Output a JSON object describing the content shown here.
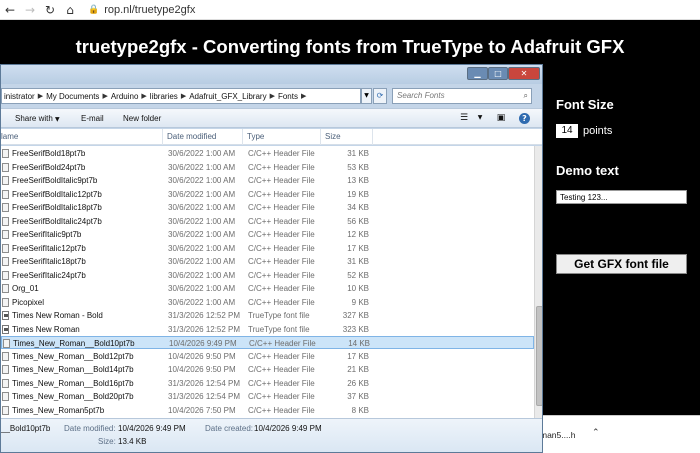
{
  "browser": {
    "url": "rop.nl/truetype2gfx"
  },
  "page": {
    "title": "truetype2gfx - Converting fonts from TrueType to Adafruit GFX",
    "font_size_label": "Font Size",
    "font_size_value": "14",
    "points_label": "points",
    "demo_text_label": "Demo text",
    "demo_text_value": "Testing 123...",
    "get_file_button": "Get GFX font file"
  },
  "download": {
    "filename": "man5....h"
  },
  "explorer": {
    "breadcrumbs": [
      "inistrator",
      "My Documents",
      "Arduino",
      "libraries",
      "Adafruit_GFX_Library",
      "Fonts"
    ],
    "search_placeholder": "Search Fonts",
    "toolbar": {
      "share": "Share with",
      "email": "E-mail",
      "new_folder": "New folder"
    },
    "columns": {
      "name": "lame",
      "date": "Date modified",
      "type": "Type",
      "size": "Size"
    },
    "files": [
      {
        "name": "FreeSerifBold18pt7b",
        "date": "30/6/2022 1:00 AM",
        "type": "C/C++ Header File",
        "size": "31 KB"
      },
      {
        "name": "FreeSerifBold24pt7b",
        "date": "30/6/2022 1:00 AM",
        "type": "C/C++ Header File",
        "size": "53 KB"
      },
      {
        "name": "FreeSerifBoldItalic9pt7b",
        "date": "30/6/2022 1:00 AM",
        "type": "C/C++ Header File",
        "size": "13 KB"
      },
      {
        "name": "FreeSerifBoldItalic12pt7b",
        "date": "30/6/2022 1:00 AM",
        "type": "C/C++ Header File",
        "size": "19 KB"
      },
      {
        "name": "FreeSerifBoldItalic18pt7b",
        "date": "30/6/2022 1:00 AM",
        "type": "C/C++ Header File",
        "size": "34 KB"
      },
      {
        "name": "FreeSerifBoldItalic24pt7b",
        "date": "30/6/2022 1:00 AM",
        "type": "C/C++ Header File",
        "size": "56 KB"
      },
      {
        "name": "FreeSerifItalic9pt7b",
        "date": "30/6/2022 1:00 AM",
        "type": "C/C++ Header File",
        "size": "12 KB"
      },
      {
        "name": "FreeSerifItalic12pt7b",
        "date": "30/6/2022 1:00 AM",
        "type": "C/C++ Header File",
        "size": "17 KB"
      },
      {
        "name": "FreeSerifItalic18pt7b",
        "date": "30/6/2022 1:00 AM",
        "type": "C/C++ Header File",
        "size": "31 KB"
      },
      {
        "name": "FreeSerifItalic24pt7b",
        "date": "30/6/2022 1:00 AM",
        "type": "C/C++ Header File",
        "size": "52 KB"
      },
      {
        "name": "Org_01",
        "date": "30/6/2022 1:00 AM",
        "type": "C/C++ Header File",
        "size": "10 KB"
      },
      {
        "name": "Picopixel",
        "date": "30/6/2022 1:00 AM",
        "type": "C/C++ Header File",
        "size": "9 KB"
      },
      {
        "name": "Times New Roman - Bold",
        "date": "31/3/2026 12:52 PM",
        "type": "TrueType font file",
        "size": "327 KB"
      },
      {
        "name": "Times New Roman",
        "date": "31/3/2026 12:52 PM",
        "type": "TrueType font file",
        "size": "323 KB"
      },
      {
        "name": "Times_New_Roman__Bold10pt7b",
        "date": "10/4/2026 9:49 PM",
        "type": "C/C++ Header File",
        "size": "14 KB"
      },
      {
        "name": "Times_New_Roman__Bold12pt7b",
        "date": "10/4/2026 9:50 PM",
        "type": "C/C++ Header File",
        "size": "17 KB"
      },
      {
        "name": "Times_New_Roman__Bold14pt7b",
        "date": "10/4/2026 9:50 PM",
        "type": "C/C++ Header File",
        "size": "21 KB"
      },
      {
        "name": "Times_New_Roman__Bold16pt7b",
        "date": "31/3/2026 12:54 PM",
        "type": "C/C++ Header File",
        "size": "26 KB"
      },
      {
        "name": "Times_New_Roman__Bold20pt7b",
        "date": "31/3/2026 12:54 PM",
        "type": "C/C++ Header File",
        "size": "37 KB"
      },
      {
        "name": "Times_New_Roman5pt7b",
        "date": "10/4/2026 7:50 PM",
        "type": "C/C++ Header File",
        "size": "8 KB"
      }
    ],
    "selected_index": 14,
    "details": {
      "name": "__Bold10pt7b",
      "date_modified_label": "Date modified:",
      "date_modified": "10/4/2026 9:49 PM",
      "date_created_label": "Date created:",
      "date_created": "10/4/2026 9:49 PM",
      "size_label": "Size:",
      "size": "13.4 KB"
    }
  }
}
